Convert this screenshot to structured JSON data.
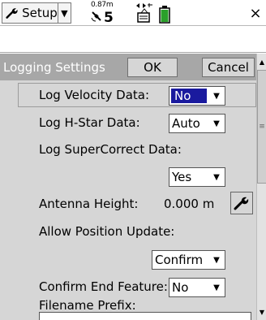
{
  "toolbar": {
    "setup_label": "Setup",
    "accuracy": "0.87m",
    "satellites": "5",
    "close_label": "×"
  },
  "form": {
    "title": "Logging Settings",
    "ok_label": "OK",
    "cancel_label": "Cancel",
    "fields": {
      "log_velocity": {
        "label": "Log Velocity Data:",
        "value": "No"
      },
      "log_hstar": {
        "label": "Log H-Star Data:",
        "value": "Auto"
      },
      "log_supercorrect": {
        "label": "Log SuperCorrect Data:",
        "value": "Yes"
      },
      "antenna_height": {
        "label": "Antenna Height:",
        "value": "0.000 m"
      },
      "allow_position_update": {
        "label": "Allow Position Update:",
        "value": "Confirm"
      },
      "confirm_end_feature": {
        "label": "Confirm End Feature:",
        "value": "No"
      },
      "filename_prefix": {
        "label": "Filename Prefix:",
        "value": ""
      }
    }
  },
  "colors": {
    "form_bg": "#d6d6d6",
    "header_bg": "#a7a7a7",
    "selection": "#1a1a9e"
  },
  "icons": {
    "setup": "wrench-icon",
    "gps": "satellite-icon",
    "battery": "battery-icon",
    "antenna": "wrench-icon"
  }
}
